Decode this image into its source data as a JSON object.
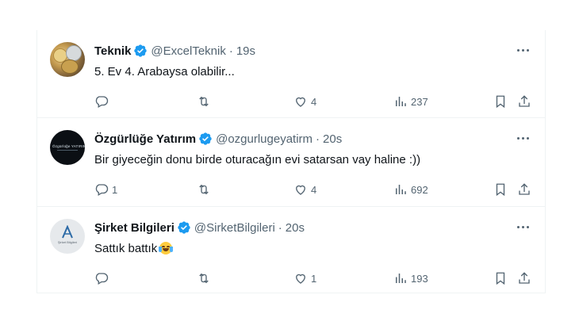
{
  "tweets": [
    {
      "name": "Teknik",
      "handle": "@ExcelTeknik",
      "separator": "·",
      "time": "19s",
      "text": "5. Ev 4. Arabaysa olabilir...",
      "replies": "",
      "retweets": "",
      "likes": "4",
      "views": "237",
      "avatar_icon": "coins-avatar"
    },
    {
      "name": "Özgürlüğe Yatırım",
      "handle": "@ozgurlugeyatirm",
      "separator": "·",
      "time": "20s",
      "text": "Bir giyeceğin donu birde oturacağın evi satarsan vay haline :))",
      "replies": "1",
      "retweets": "",
      "likes": "4",
      "views": "692",
      "avatar_icon": "ozgurluge-yatirim-logo",
      "avatar_text": "Özgürlüğe YATIRIM"
    },
    {
      "name": "Şirket Bilgileri",
      "handle": "@SirketBilgileri",
      "separator": "·",
      "time": "20s",
      "text": "Sattık battık",
      "text_emoji": "face-with-tears-of-joy",
      "replies": "",
      "retweets": "",
      "likes": "1",
      "views": "193",
      "avatar_icon": "sirket-bilgileri-logo",
      "avatar_text": "Şirket Bilgileri"
    }
  ],
  "colors": {
    "text_primary": "#0f1419",
    "text_secondary": "#536471",
    "verified_badge": "#1d9bf0",
    "divider": "#eff3f4"
  }
}
